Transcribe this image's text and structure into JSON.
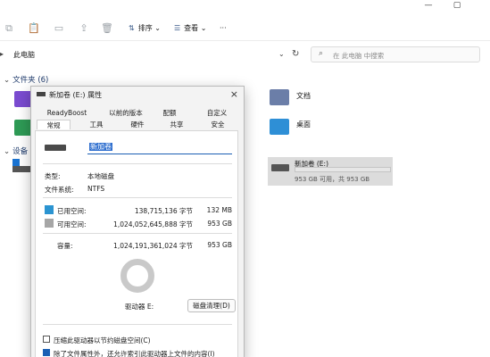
{
  "explorer": {
    "window_controls": [
      "—",
      "▢"
    ],
    "toolbar": {
      "sort_label": "排序",
      "view_label": "查看",
      "more_label": "···"
    },
    "address": {
      "path": "此电脑"
    },
    "search": {
      "placeholder": "在 此电脑 中搜索"
    },
    "folders_header": "文件夹 (6)",
    "folders": [
      {
        "name": "文档",
        "color": "#6b7ea8"
      },
      {
        "name": "桌面",
        "color": "#2e8fd6"
      }
    ],
    "devices_header": "设备",
    "drive": {
      "name": "新加卷 (E:)",
      "free_text": "953 GB 可用，共 953 GB",
      "used_fraction": 0.0
    }
  },
  "dialog": {
    "title": "新加卷 (E:) 属性",
    "close_icon": "×",
    "tabs_row1": [
      "ReadyBoost",
      "以前的版本",
      "配额",
      "自定义"
    ],
    "tabs_row2": [
      "常规",
      "工具",
      "硬件",
      "共享",
      "安全"
    ],
    "active_tab": "常规",
    "volume_name": "新加卷",
    "type_label": "类型:",
    "type_value": "本地磁盘",
    "fs_label": "文件系统:",
    "fs_value": "NTFS",
    "used": {
      "label": "已用空间:",
      "bytes": "138,715,136 字节",
      "size": "132 MB",
      "color": "#2b94d1"
    },
    "free": {
      "label": "可用空间:",
      "bytes": "1,024,052,645,888 字节",
      "size": "953 GB",
      "color": "#a6a6a6"
    },
    "capacity": {
      "label": "容量:",
      "bytes": "1,024,191,361,024 字节",
      "size": "953 GB"
    },
    "drive_label": "驱动器 E:",
    "cleanup_button": "磁盘清理(D)",
    "compress_label": "压缩此驱动器以节约磁盘空间(C)",
    "index_label": "除了文件属性外，还允许索引此驱动器上文件的内容(I)"
  }
}
